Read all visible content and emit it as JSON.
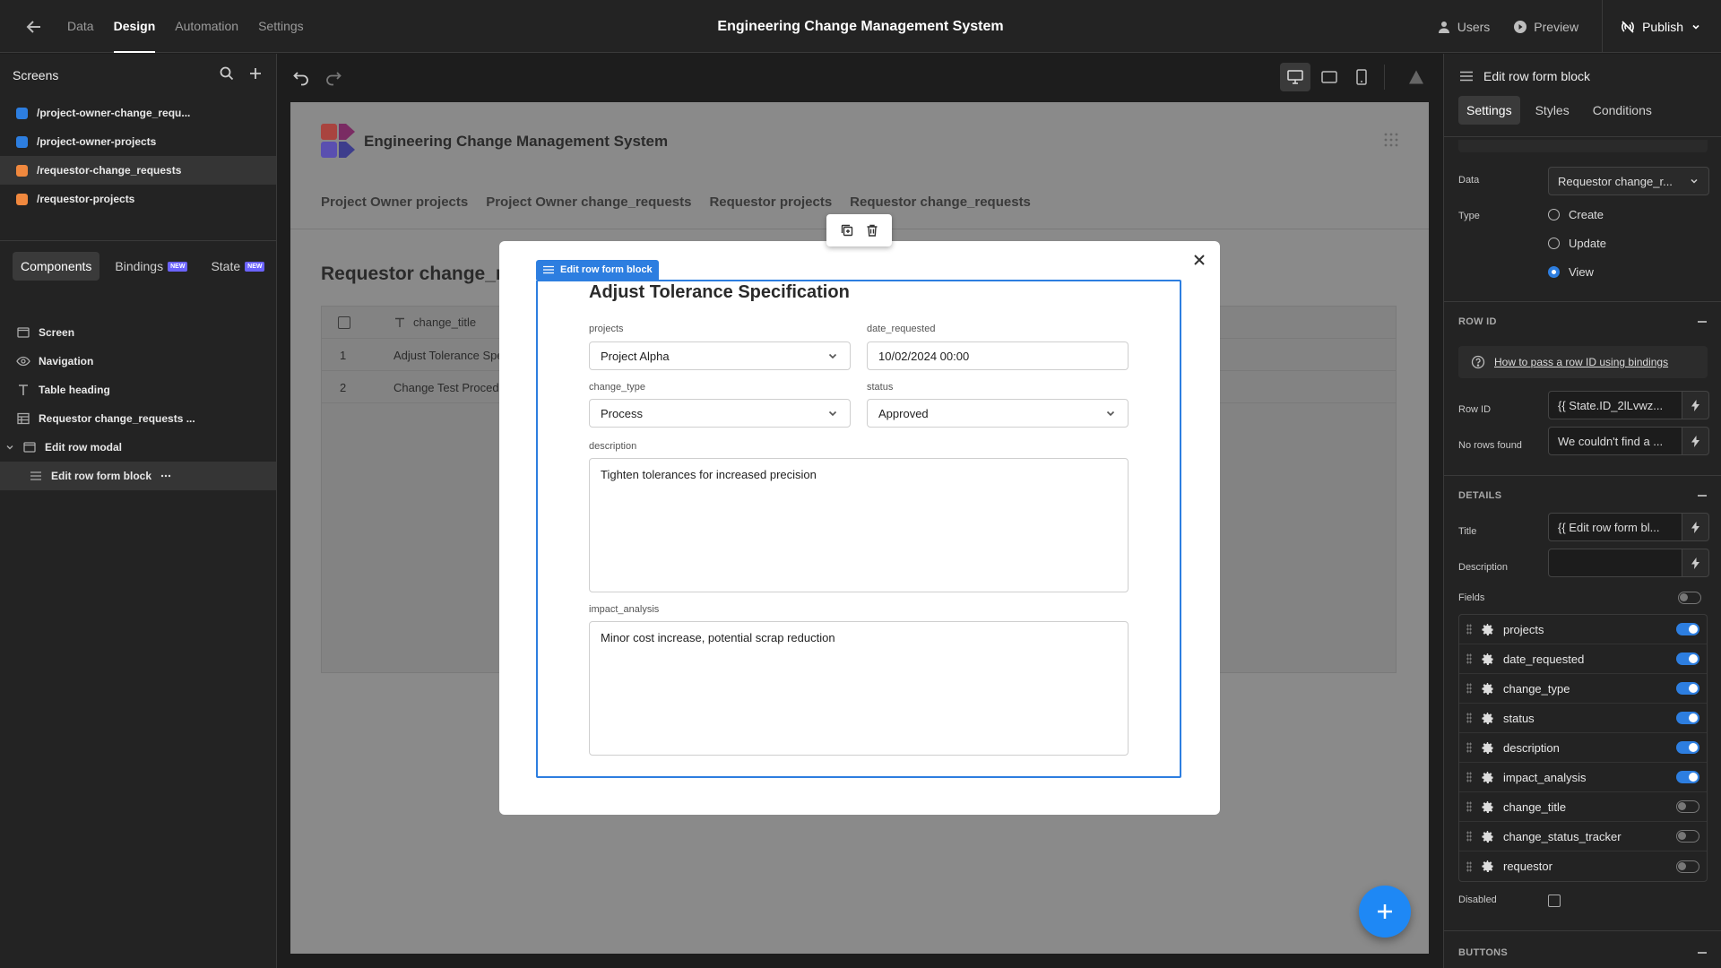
{
  "topbar": {
    "tabs": [
      "Data",
      "Design",
      "Automation",
      "Settings"
    ],
    "active_tab": "Design",
    "app_title": "Engineering Change Management System",
    "users_label": "Users",
    "preview_label": "Preview",
    "publish_label": "Publish"
  },
  "left": {
    "screens_title": "Screens",
    "screens": [
      {
        "path": "/project-owner-change_requ...",
        "color": "#2d7ee0"
      },
      {
        "path": "/project-owner-projects",
        "color": "#2d7ee0"
      },
      {
        "path": "/requestor-change_requests",
        "color": "#f0883e"
      },
      {
        "path": "/requestor-projects",
        "color": "#f0883e"
      }
    ],
    "tabs": [
      {
        "label": "Components",
        "badge": ""
      },
      {
        "label": "Bindings",
        "badge": "NEW"
      },
      {
        "label": "State",
        "badge": "NEW"
      }
    ],
    "tree": [
      {
        "label": "Screen",
        "icon": "screen-icon"
      },
      {
        "label": "Navigation",
        "icon": "eye-icon"
      },
      {
        "label": "Table heading",
        "icon": "text-icon"
      },
      {
        "label": "Requestor change_requests ...",
        "icon": "table-icon"
      },
      {
        "label": "Edit row modal",
        "icon": "modal-icon"
      },
      {
        "label": "Edit row form block",
        "icon": "form-icon"
      }
    ]
  },
  "canvas": {
    "app_title": "Engineering Change Management System",
    "nav": [
      "Project Owner projects",
      "Project Owner change_requests",
      "Requestor projects",
      "Requestor change_requests"
    ],
    "heading": "Requestor change_re",
    "table": {
      "column": "change_title",
      "rows": [
        {
          "n": "1",
          "v": "Adjust Tolerance Spe"
        },
        {
          "n": "2",
          "v": "Change Test Procedu"
        }
      ]
    }
  },
  "modal": {
    "block_tag": "Edit row form block",
    "title": "Adjust Tolerance Specification",
    "fields": {
      "projects": {
        "label": "projects",
        "value": "Project Alpha"
      },
      "date_requested": {
        "label": "date_requested",
        "value": "10/02/2024 00:00"
      },
      "change_type": {
        "label": "change_type",
        "value": "Process"
      },
      "status": {
        "label": "status",
        "value": "Approved"
      },
      "description": {
        "label": "description",
        "value": "Tighten tolerances for increased precision"
      },
      "impact_analysis": {
        "label": "impact_analysis",
        "value": "Minor cost increase, potential scrap reduction"
      }
    }
  },
  "right": {
    "title": "Edit row form block",
    "tabs": [
      "Settings",
      "Styles",
      "Conditions"
    ],
    "data_label": "Data",
    "data_value": "Requestor change_r...",
    "type_label": "Type",
    "type_options": [
      "Create",
      "Update",
      "View"
    ],
    "type_selected": "View",
    "row_id_section": "ROW ID",
    "row_id_help": "How to pass a row ID using bindings",
    "row_id_label": "Row ID",
    "row_id_value": "{{ State.ID_2lLvwz...",
    "no_rows_label": "No rows found",
    "no_rows_value": "We couldn't find a ...",
    "details_section": "DETAILS",
    "title_label": "Title",
    "title_value": "{{ Edit row form bl...",
    "description_label": "Description",
    "description_value": "",
    "fields_label": "Fields",
    "fields": [
      {
        "name": "projects",
        "on": true
      },
      {
        "name": "date_requested",
        "on": true
      },
      {
        "name": "change_type",
        "on": true
      },
      {
        "name": "status",
        "on": true
      },
      {
        "name": "description",
        "on": true
      },
      {
        "name": "impact_analysis",
        "on": true
      },
      {
        "name": "change_title",
        "on": false
      },
      {
        "name": "change_status_tracker",
        "on": false
      },
      {
        "name": "requestor",
        "on": false
      }
    ],
    "disabled_label": "Disabled",
    "buttons_section": "BUTTONS"
  }
}
